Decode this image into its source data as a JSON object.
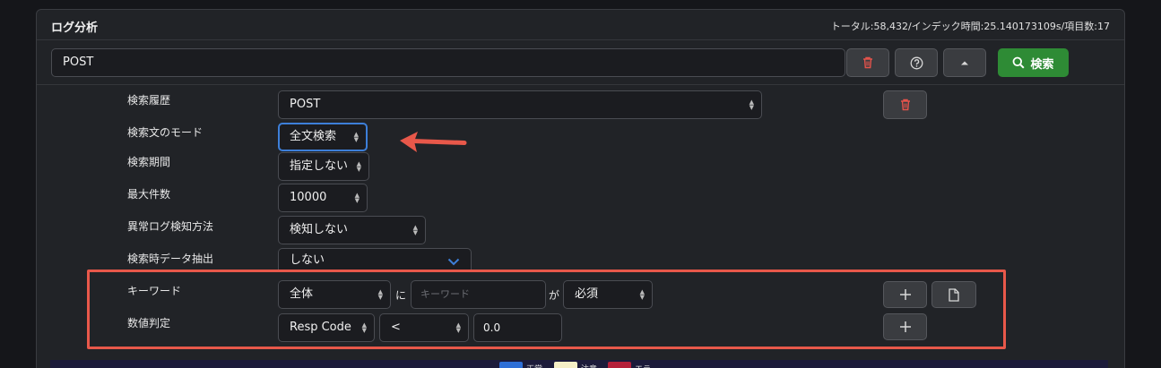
{
  "panel": {
    "title": "ログ分析",
    "stats": "トータル:58,432/インデック時間:25.140173109s/項目数:17"
  },
  "search": {
    "query": "POST",
    "search_button_label": "検索"
  },
  "fields": {
    "history": {
      "label": "検索履歴",
      "value": "POST"
    },
    "mode": {
      "label": "検索文のモード",
      "value": "全文検索"
    },
    "period": {
      "label": "検索期間",
      "value": "指定しない"
    },
    "max_count": {
      "label": "最大件数",
      "value": "10000"
    },
    "anomaly": {
      "label": "異常ログ検知方法",
      "value": "検知しない"
    },
    "extract": {
      "label": "検索時データ抽出",
      "value": "しない"
    },
    "keyword": {
      "label": "キーワード",
      "scope": "全体",
      "particle_ni": "に",
      "placeholder": "キーワード",
      "particle_ga": "が",
      "condition": "必須"
    },
    "numeric": {
      "label": "数値判定",
      "field": "Resp Code",
      "operator": "<",
      "value": "0.0"
    }
  },
  "legend": [
    {
      "label": "正常",
      "color": "#2f6fd6"
    },
    {
      "label": "注意",
      "color": "#f5efc6"
    },
    {
      "label": "エラ",
      "color": "#b5203a"
    }
  ],
  "colors": {
    "accent": "#3d7fd9",
    "search_button": "#2e8b35",
    "delete_icon": "#e5534b",
    "highlight": "#e8584a"
  },
  "icons": [
    "trash-icon",
    "help-icon",
    "caret-up-icon",
    "search-icon",
    "plus-icon",
    "file-icon",
    "chevron-down-icon",
    "arrow-icon"
  ]
}
